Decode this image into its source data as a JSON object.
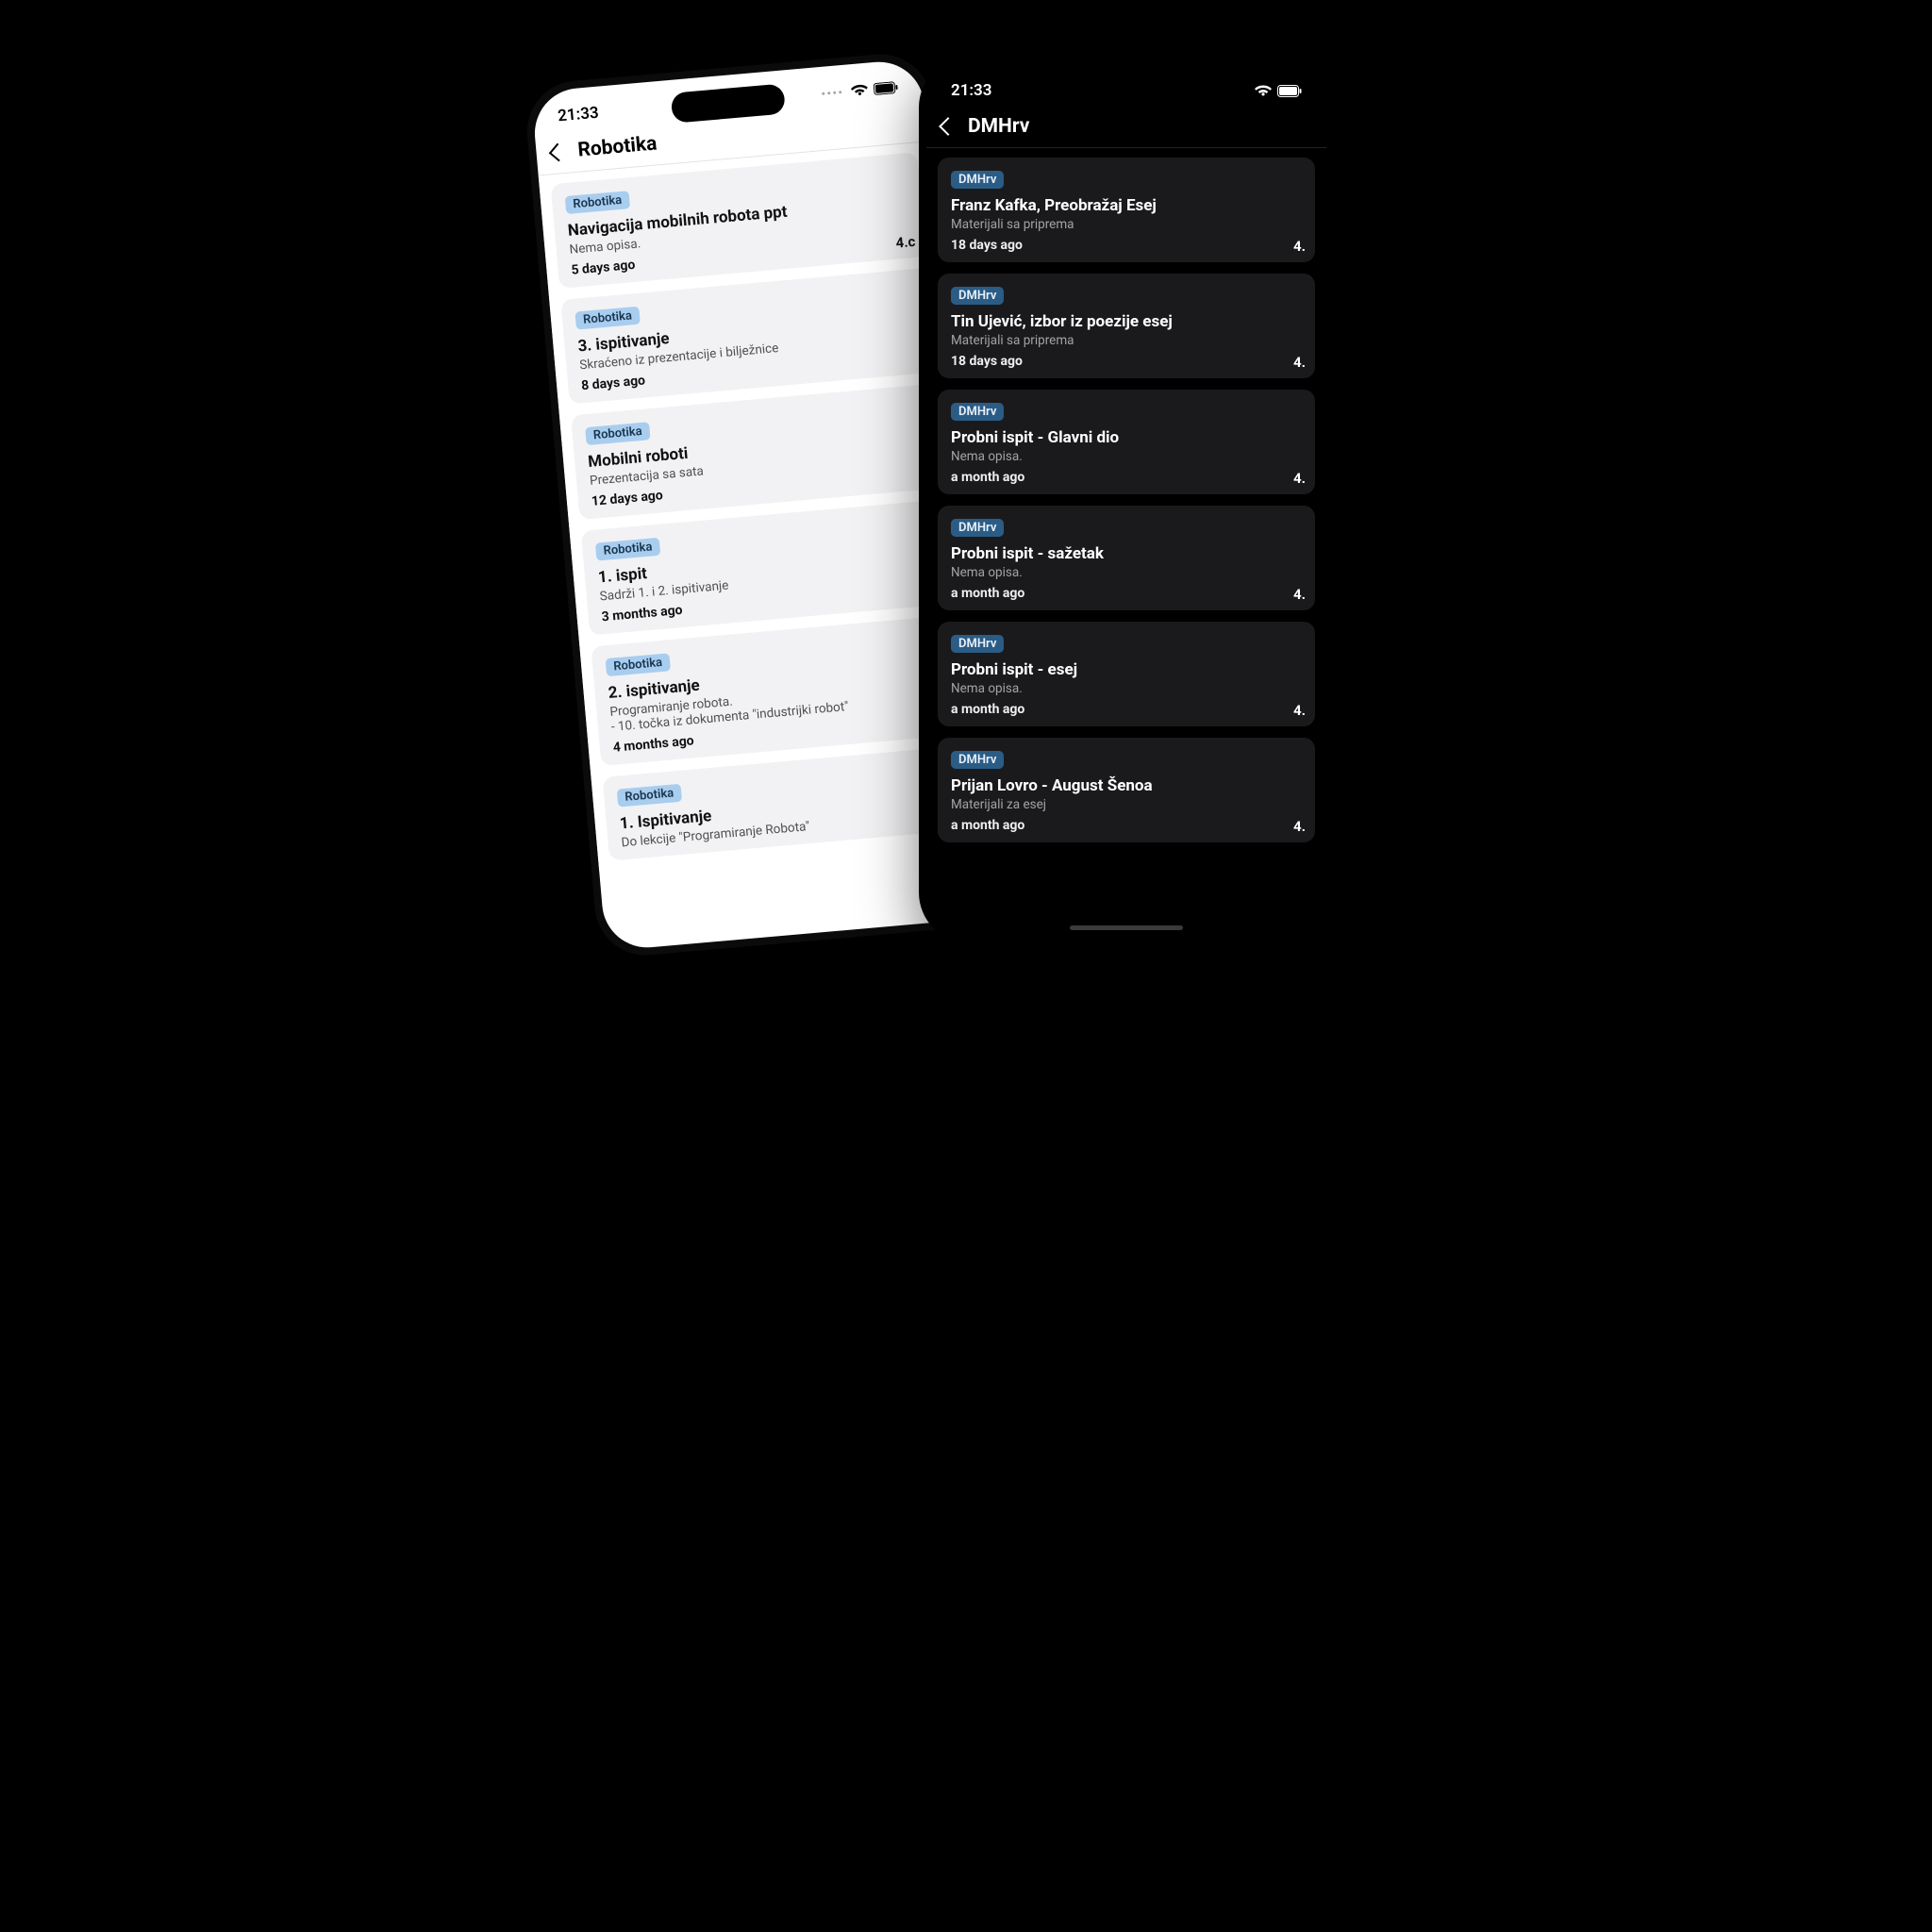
{
  "status_time": "21:33",
  "left": {
    "heading": "Robotika",
    "tag": "Robotika",
    "items": [
      {
        "title": "Navigacija mobilnih robota ppt",
        "desc": "Nema opisa.",
        "age": "5 days ago",
        "grade": "4.c"
      },
      {
        "title": "3. ispitivanje",
        "desc": "Skraćeno iz prezentacije i bilježnice",
        "age": "8 days ago",
        "grade": ""
      },
      {
        "title": "Mobilni roboti",
        "desc": "Prezentacija sa sata",
        "age": "12 days ago",
        "grade": ""
      },
      {
        "title": "1. ispit",
        "desc": "Sadrži 1. i 2. ispitivanje",
        "age": "3 months ago",
        "grade": ""
      },
      {
        "title": "2. ispitivanje",
        "desc": "Programiranje robota.\n- 10. točka iz dokumenta \"industrijki robot\"",
        "age": "4 months ago",
        "grade": ""
      },
      {
        "title": "1. Ispitivanje",
        "desc": "Do lekcije \"Programiranje Robota\"",
        "age": "",
        "grade": ""
      }
    ]
  },
  "right": {
    "heading": "DMHrv",
    "tag": "DMHrv",
    "items": [
      {
        "title": "Franz Kafka, Preobražaj Esej",
        "desc": "Materijali sa priprema",
        "age": "18 days ago",
        "grade": "4."
      },
      {
        "title": "Tin Ujević, izbor iz poezije esej",
        "desc": "Materijali sa priprema",
        "age": "18 days ago",
        "grade": "4."
      },
      {
        "title": "Probni ispit - Glavni dio",
        "desc": "Nema opisa.",
        "age": "a month ago",
        "grade": "4."
      },
      {
        "title": "Probni ispit - sažetak",
        "desc": "Nema opisa.",
        "age": "a month ago",
        "grade": "4."
      },
      {
        "title": "Probni ispit - esej",
        "desc": "Nema opisa.",
        "age": "a month ago",
        "grade": "4."
      },
      {
        "title": "Prijan Lovro - August Šenoa",
        "desc": "Materijali za esej",
        "age": "a month ago",
        "grade": "4."
      }
    ]
  }
}
